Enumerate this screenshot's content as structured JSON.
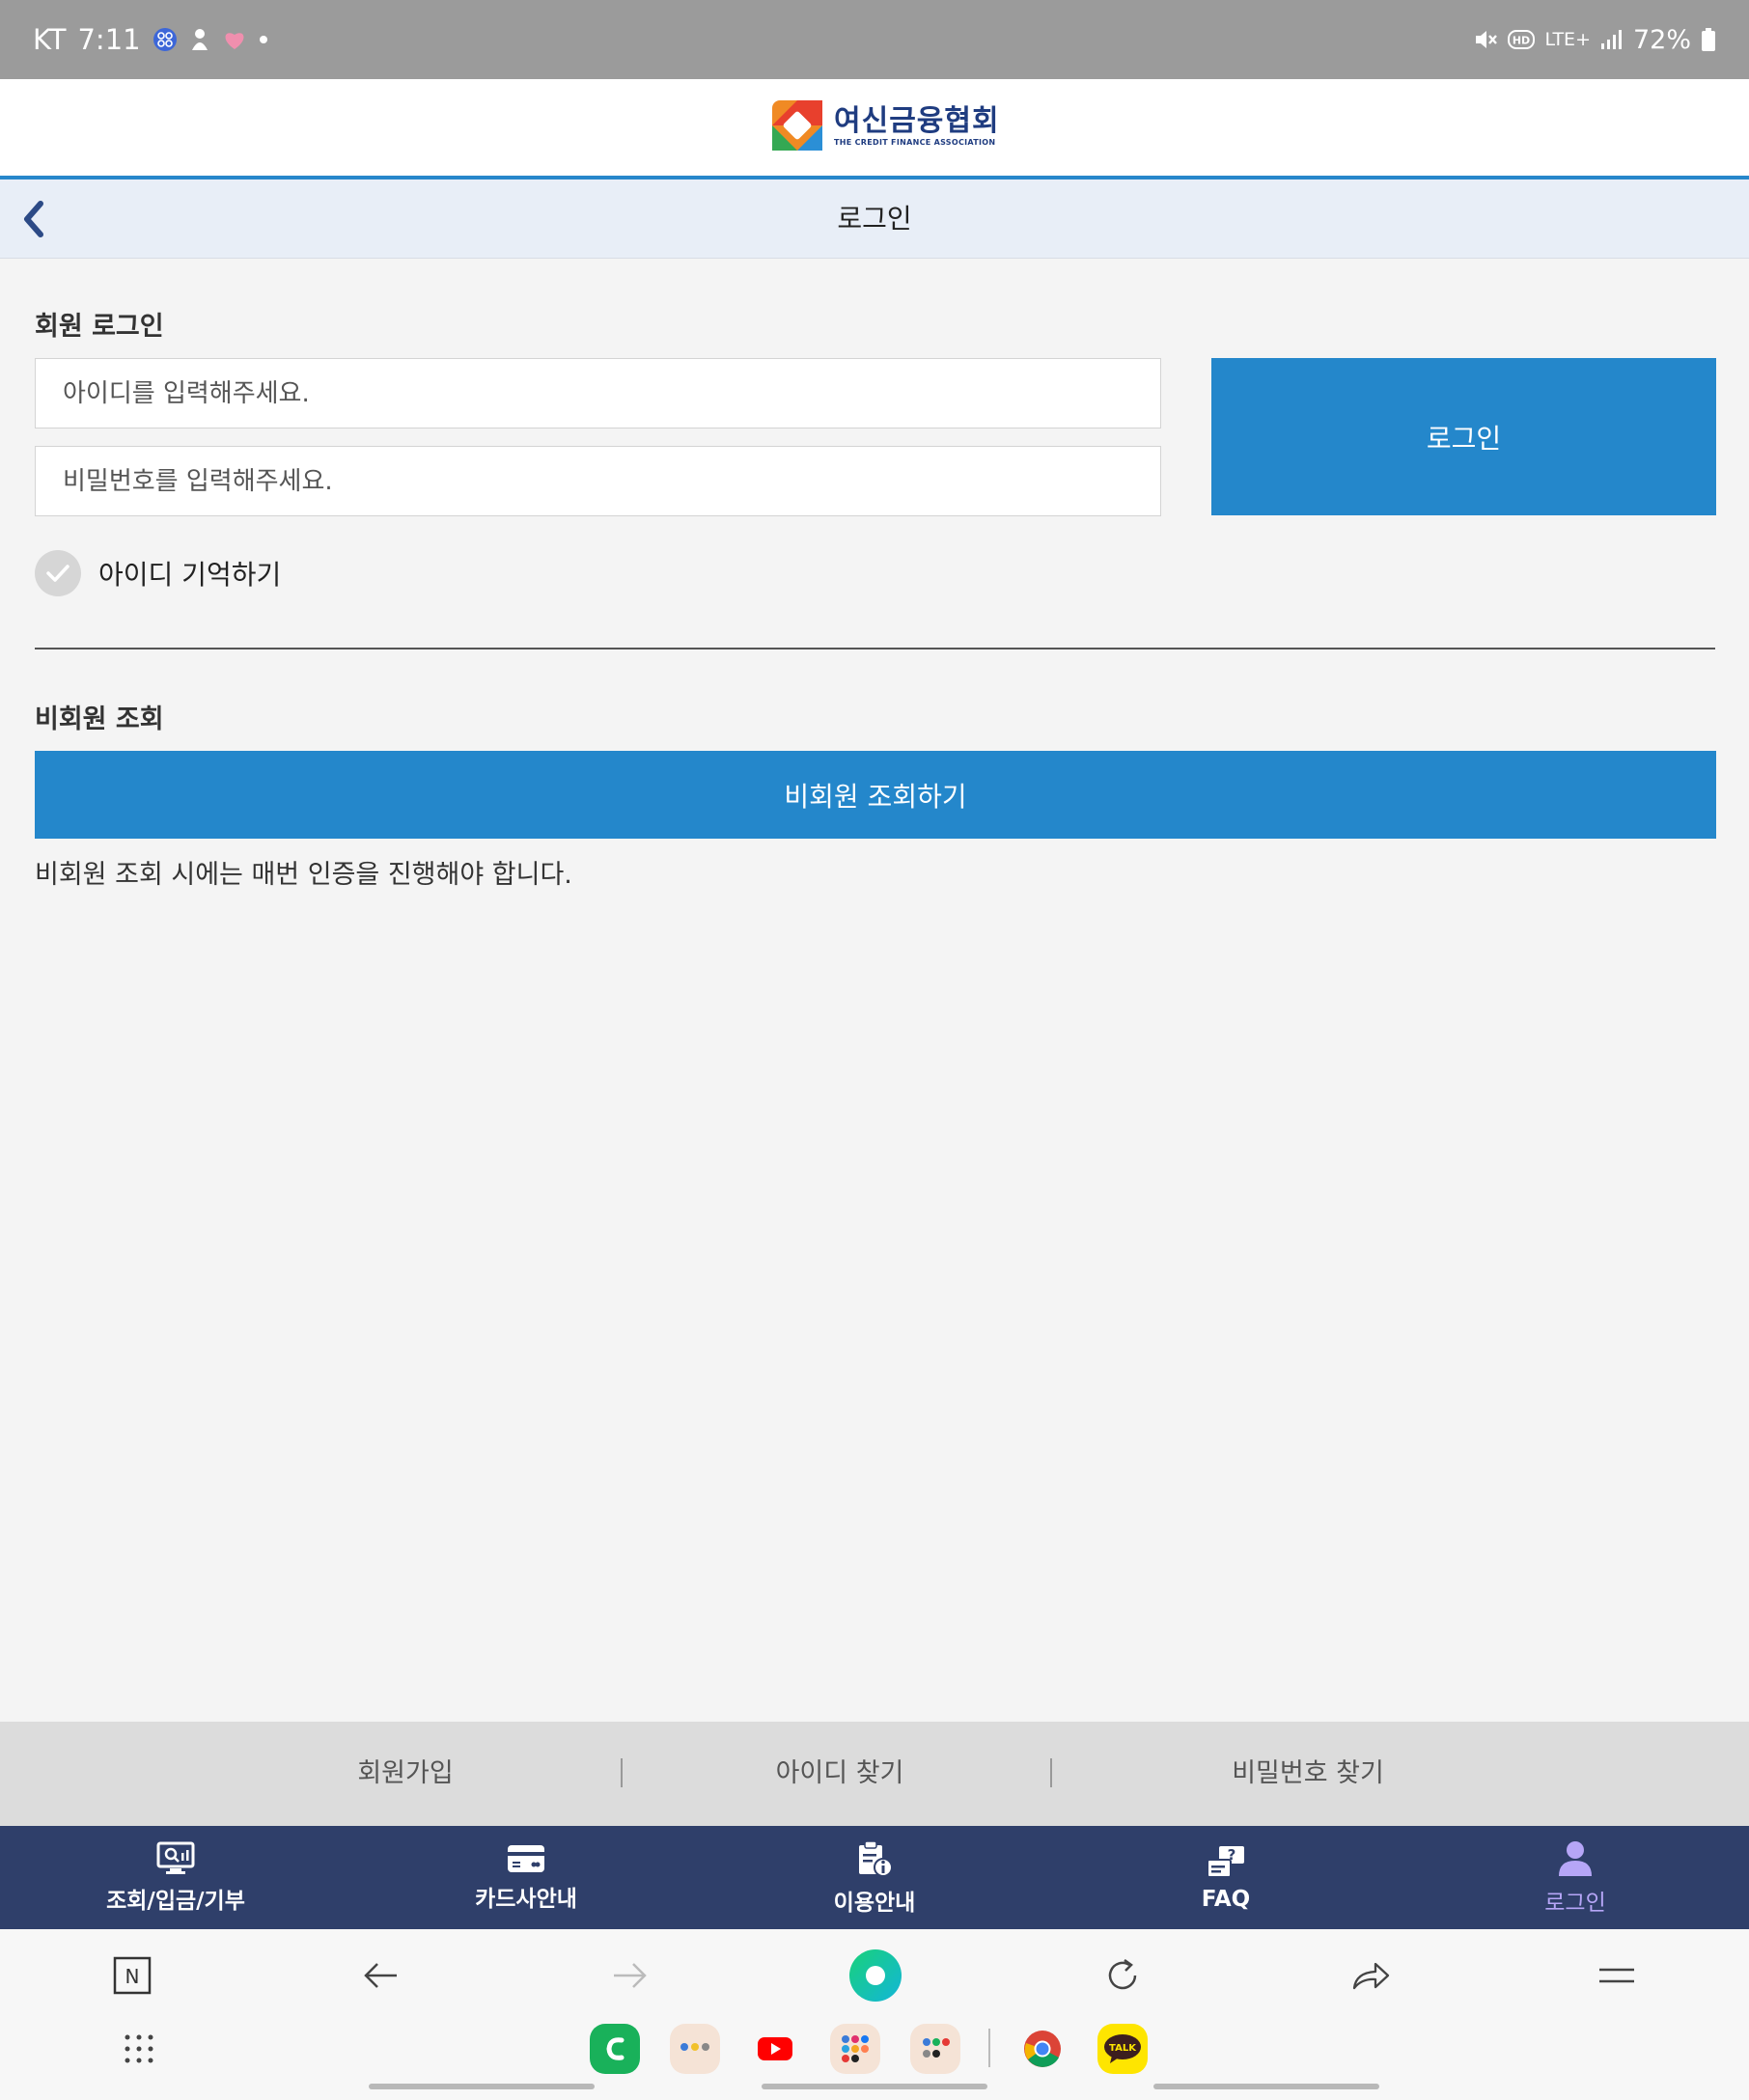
{
  "status_bar": {
    "carrier": "KT",
    "time": "7:11",
    "network": "LTE+",
    "battery": "72%"
  },
  "brand": {
    "name": "여신금융협회",
    "subtitle": "THE CREDIT FINANCE ASSOCIATION",
    "accent_color": "#2487cb",
    "navy_color": "#2f3f6a"
  },
  "title_bar": {
    "title": "로그인"
  },
  "member_login": {
    "section_label": "회원 로그인",
    "id_placeholder": "아이디를 입력해주세요.",
    "id_value": "",
    "password_placeholder": "비밀번호를 입력해주세요.",
    "password_value": "",
    "login_button": "로그인",
    "remember_label": "아이디 기억하기",
    "remember_checked": false
  },
  "guest": {
    "section_label": "비회원 조회",
    "button": "비회원 조회하기",
    "note": "비회원 조회 시에는 매번 인증을 진행해야 합니다."
  },
  "footer_links": [
    {
      "label": "회원가입"
    },
    {
      "label": "아이디 찾기"
    },
    {
      "label": "비밀번호 찾기"
    }
  ],
  "bottom_nav": [
    {
      "label": "조회/입금/기부",
      "icon": "monitor-search-icon"
    },
    {
      "label": "카드사안내",
      "icon": "card-icon"
    },
    {
      "label": "이용안내",
      "icon": "clipboard-info-icon"
    },
    {
      "label": "FAQ",
      "icon": "faq-icon"
    },
    {
      "label": "로그인",
      "icon": "user-icon",
      "active": true
    }
  ],
  "browser_toolbar": {
    "tab_badge": "N",
    "dock_labels": {
      "kakaotalk": "TALK"
    }
  }
}
